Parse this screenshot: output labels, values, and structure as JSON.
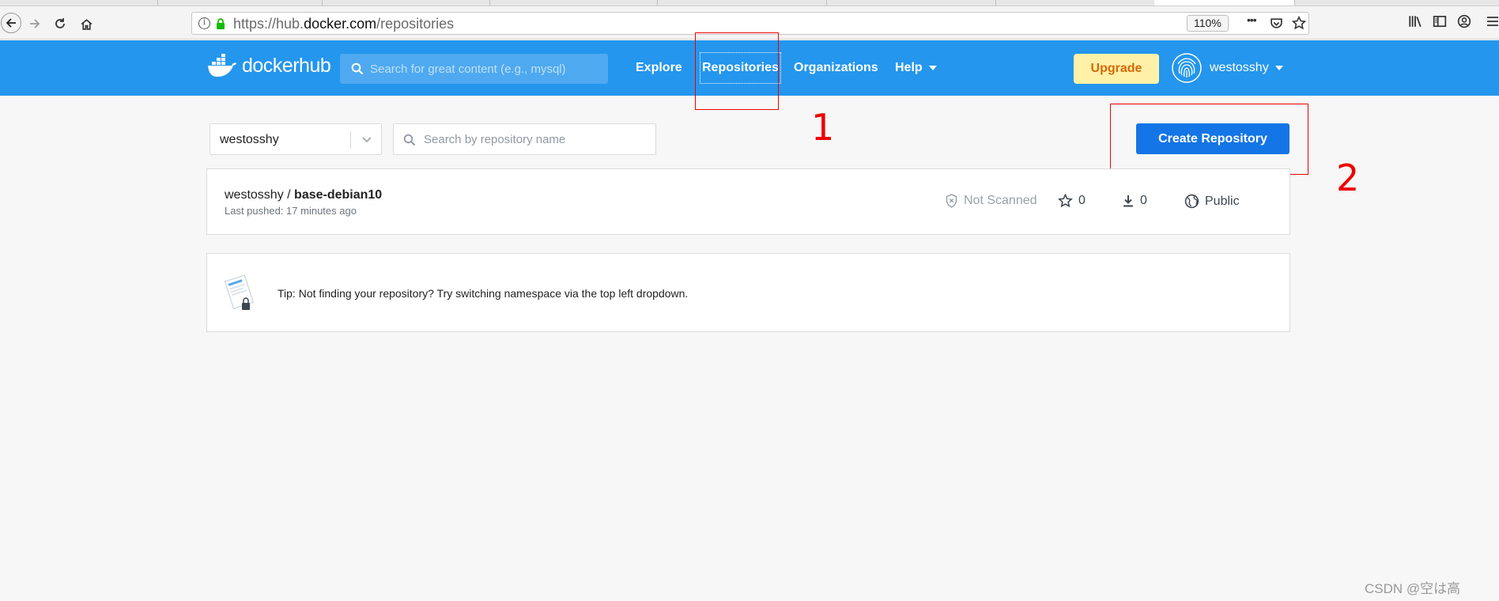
{
  "browser": {
    "url_prefix": "https://hub.",
    "url_domain": "docker.com",
    "url_path": "/repositories",
    "zoom": "110%",
    "more_label": "•••"
  },
  "header": {
    "logo_text": "dockerhub",
    "search_placeholder": "Search for great content (e.g., mysql)",
    "nav": {
      "explore": "Explore",
      "repositories": "Repositories",
      "organizations": "Organizations",
      "help": "Help"
    },
    "upgrade_label": "Upgrade",
    "username": "westosshy"
  },
  "annotations": {
    "one": "1",
    "two": "2"
  },
  "toolbar": {
    "namespace": "westosshy",
    "repo_search_placeholder": "Search by repository name",
    "create_label": "Create Repository"
  },
  "repositories": [
    {
      "namespace": "westosshy",
      "separator": " / ",
      "name": "base-debian10",
      "last_pushed": "Last pushed: 17 minutes ago",
      "scan_status": "Not Scanned",
      "stars": "0",
      "downloads": "0",
      "visibility": "Public"
    }
  ],
  "tip": {
    "text": "Tip: Not finding your repository? Try switching namespace via the top left dropdown."
  },
  "watermark": "CSDN @空は高",
  "colors": {
    "header_bg": "#2496ed",
    "primary_button": "#1475e6",
    "upgrade_bg": "#fff1a8",
    "upgrade_text": "#d46b08",
    "annotation": "#e00000"
  }
}
